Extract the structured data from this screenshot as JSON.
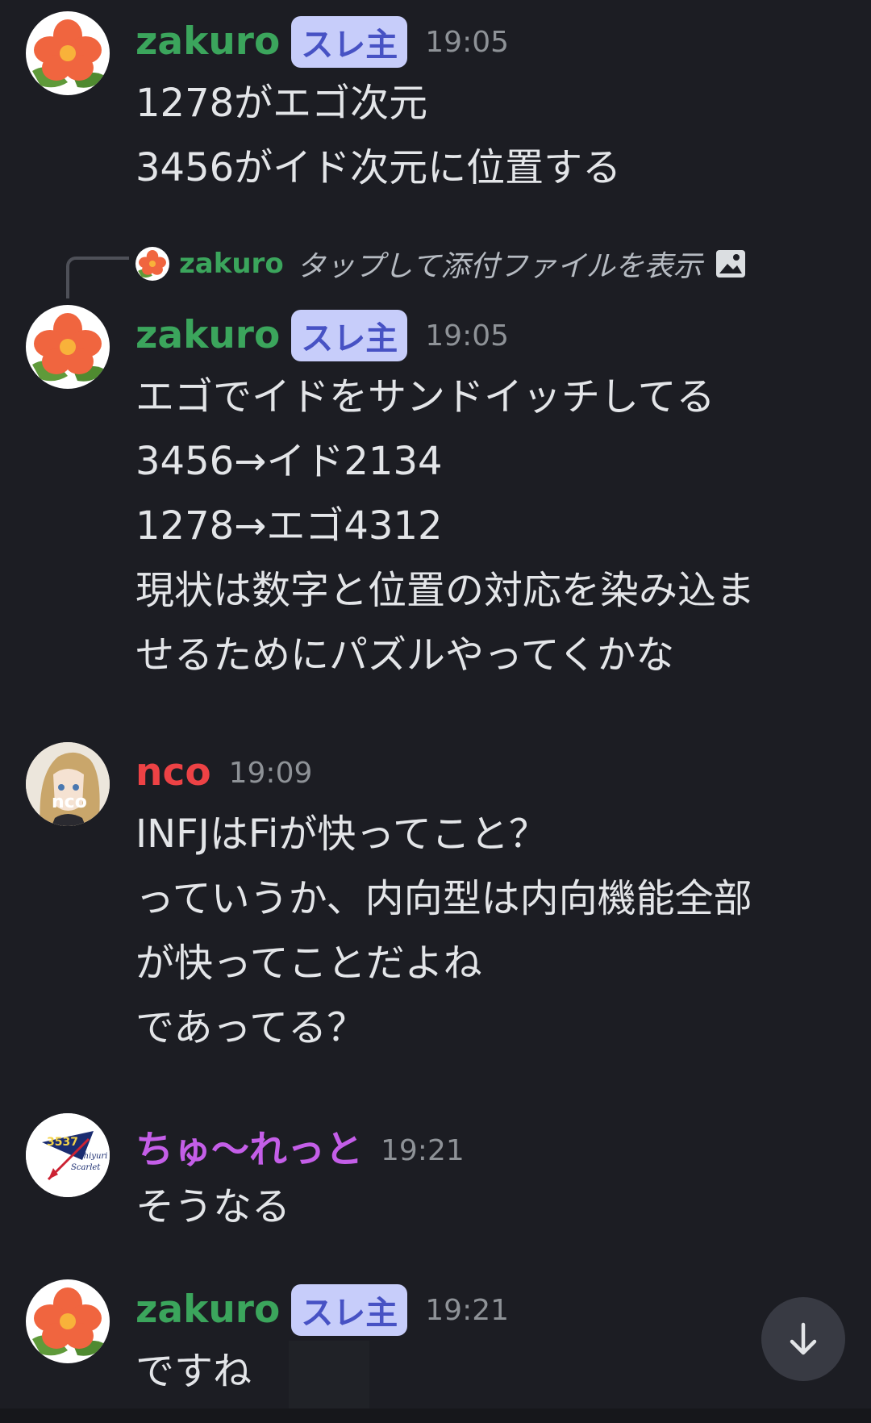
{
  "colors": {
    "background": "#1c1d23",
    "zakuro_name": "#3ba55c",
    "nco_name": "#ed4245",
    "chulet_name": "#c45ee8",
    "op_badge_bg": "#c7cdfa",
    "op_badge_text": "#4752c4",
    "timestamp": "#8e9297"
  },
  "messages": [
    {
      "author": "zakuro",
      "badge": "スレ主",
      "time": "19:05",
      "lines": [
        "1278がエゴ次元",
        "3456がイド次元に位置する"
      ],
      "avatar_icon": "red-flower-icon"
    },
    {
      "reply": {
        "author": "zakuro",
        "text": "タップして添付ファイルを表示",
        "icon": "image-icon"
      },
      "author": "zakuro",
      "badge": "スレ主",
      "time": "19:05",
      "lines": [
        "エゴでイドをサンドイッチしてる",
        "3456→イド2134",
        "1278→エゴ4312",
        "現状は数字と位置の対応を染み込ま",
        "せるためにパズルやってくかな"
      ],
      "avatar_icon": "red-flower-icon"
    },
    {
      "author": "nco",
      "time": "19:09",
      "avatar_text": "nco",
      "lines": [
        "INFJはFiが快ってこと？",
        "っていうか、内向型は内向機能全部",
        "が快ってことだよね",
        "であってる？"
      ],
      "avatar_icon": "anime-portrait-icon"
    },
    {
      "author": "ちゅ〜れっと",
      "time": "19:21",
      "lines": [
        "そうなる"
      ],
      "avatar_icon": "logo-icon",
      "avatar_logo": {
        "number": "3537",
        "line1": "Chiyuri",
        "line2": "Scarlet"
      }
    },
    {
      "author": "zakuro",
      "badge": "スレ主",
      "time": "19:21",
      "lines": [
        "ですね"
      ],
      "avatar_icon": "red-flower-icon"
    }
  ],
  "scroll_button": {
    "icon": "arrow-down-icon"
  }
}
